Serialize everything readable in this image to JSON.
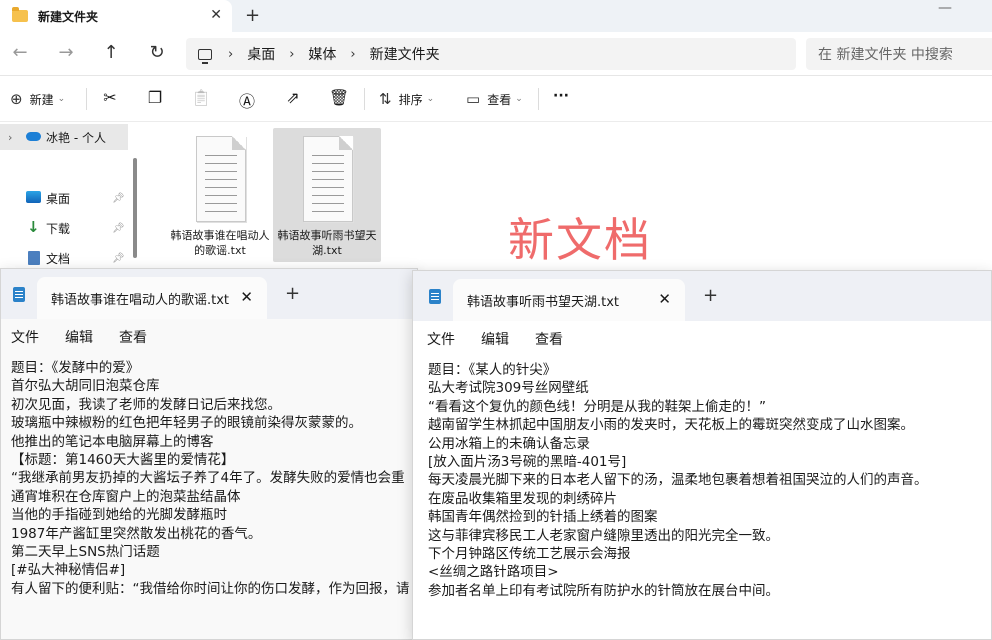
{
  "explorer": {
    "tab_title": "新建文件夹",
    "breadcrumb": [
      "桌面",
      "媒体",
      "新建文件夹"
    ],
    "search_placeholder": "在 新建文件夹 中搜索",
    "commands": {
      "new_label": "新建",
      "sort_label": "排序",
      "view_label": "查看",
      "more_label": "···"
    },
    "nav": {
      "onedrive": "冰艳 - 个人",
      "desktop": "桌面",
      "downloads": "下载",
      "documents": "文档"
    },
    "files": [
      {
        "name": "韩语故事谁在唱动人的歌谣.txt"
      },
      {
        "name": "韩语故事听雨书望天湖.txt"
      }
    ],
    "watermark": "新文档"
  },
  "notepad_left": {
    "tab_title": "韩语故事谁在唱动人的歌谣.txt",
    "menu": [
      "文件",
      "编辑",
      "查看"
    ],
    "lines": [
      "题目：《发酵中的爱》",
      "首尔弘大胡同旧泡菜仓库",
      "初次见面，我读了老师的发酵日记后来找您。",
      "玻璃瓶中辣椒粉的红色把年轻男子的眼镜前染得灰蒙蒙的。",
      "他推出的笔记本电脑屏幕上的博客",
      "【标题：第1460天大酱里的爱情花】",
      "“我继承前男友扔掉的大酱坛子养了4年了。发酵失败的爱情也会重",
      "通宵堆积在仓库窗户上的泡菜盐结晶体",
      "当他的手指碰到她给的光脚发酵瓶时",
      "1987年产酱缸里突然散发出桃花的香气。",
      "第二天早上SNS热门话题",
      "[#弘大神秘情侣#]",
      "有人留下的便利贴：“我借给你时间让你的伤口发酵，作为回报，请"
    ]
  },
  "notepad_right": {
    "tab_title": "韩语故事听雨书望天湖.txt",
    "menu": [
      "文件",
      "编辑",
      "查看"
    ],
    "lines": [
      "题目：《某人的针尖》",
      "弘大考试院309号丝网壁纸",
      "“看看这个复仇的颜色线！分明是从我的鞋架上偷走的！”",
      "越南留学生林抓起中国朋友小雨的发夹时，天花板上的霉斑突然变成了山水图案。",
      "公用冰箱上的未确认备忘录",
      "[放入面片汤3号碗的黑暗-401号]",
      "每天凌晨光脚下来的日本老人留下的汤，温柔地包裹着想着祖国哭泣的人们的声音。",
      "在废品收集箱里发现的刺绣碎片",
      "韩国青年偶然捡到的针插上绣着的图案",
      "这与菲律宾移民工人老家窗户缝隙里透出的阳光完全一致。",
      "下个月钟路区传统工艺展示会海报",
      "<丝绸之路针路项目>",
      "参加者名单上印有考试院所有防护水的针筒放在展台中间。"
    ]
  }
}
